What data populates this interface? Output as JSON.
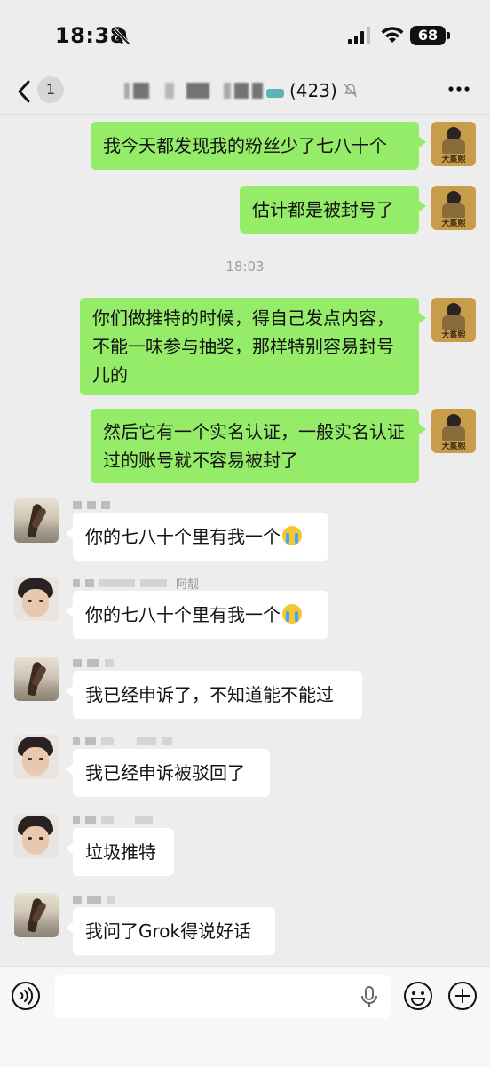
{
  "status_bar": {
    "time": "18:38",
    "battery": "68"
  },
  "nav": {
    "back_badge": "1",
    "member_count": "(423)"
  },
  "timestamp": "18:03",
  "messages": [
    {
      "from": "me",
      "text": "我今天都发现我的粉丝少了七八十个"
    },
    {
      "from": "me",
      "text": "估计都是被封号了"
    },
    {
      "from": "me",
      "text": "你们做推特的时候，得自己发点内容，不能一味参与抽奖，那样特别容易封号儿的"
    },
    {
      "from": "me",
      "text": "然后它有一个实名认证，一般实名认证过的账号就不容易被封了"
    },
    {
      "from": "other",
      "avatar": "eagle",
      "text": "你的七八十个里有我一个"
    },
    {
      "from": "other",
      "avatar": "boy",
      "sender_suffix": "阿靓",
      "text": "你的七八十个里有我一个"
    },
    {
      "from": "other",
      "avatar": "eagle",
      "text": "我已经申诉了，不知道能不能过"
    },
    {
      "from": "other",
      "avatar": "boy",
      "text": "我已经申诉被驳回了"
    },
    {
      "from": "other",
      "avatar": "boy",
      "text": "垃圾推特"
    },
    {
      "from": "other",
      "avatar": "eagle",
      "text": "我问了Grok得说好话"
    }
  ],
  "my_avatar_text": "大蒸熙",
  "colors": {
    "my_bubble": "#95ec69",
    "other_bubble": "#ffffff",
    "background": "#ededed"
  },
  "icons": [
    "back-chevron-icon",
    "mute-bell-icon",
    "more-icon",
    "voice-icon",
    "microphone-icon",
    "emoji-icon",
    "plus-icon"
  ]
}
